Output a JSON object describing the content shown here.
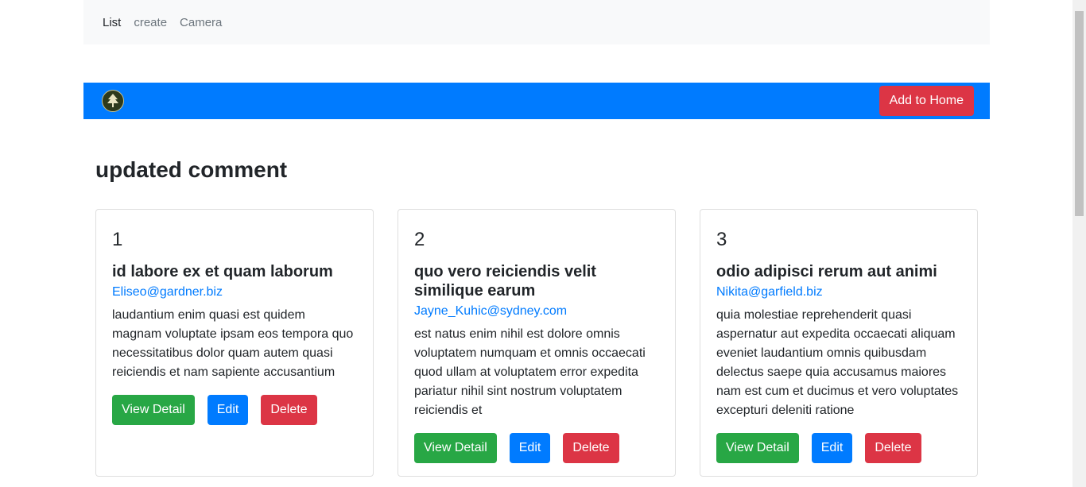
{
  "nav": {
    "items": [
      {
        "label": "List",
        "active": true
      },
      {
        "label": "create",
        "active": false
      },
      {
        "label": "Camera",
        "active": false
      }
    ]
  },
  "header": {
    "logo_icon": "tree-logo-icon",
    "add_home_label": "Add to Home",
    "bar_color": "#007bff"
  },
  "page_title": "updated comment",
  "buttons": {
    "view": "View Detail",
    "edit": "Edit",
    "delete": "Delete"
  },
  "cards": [
    {
      "id": "1",
      "title": "id labore ex et quam laborum",
      "email": "Eliseo@gardner.biz",
      "body": "laudantium enim quasi est quidem magnam voluptate ipsam eos tempora quo necessitatibus dolor quam autem quasi reiciendis et nam sapiente accusantium"
    },
    {
      "id": "2",
      "title": "quo vero reiciendis velit similique earum",
      "email": "Jayne_Kuhic@sydney.com",
      "body": "est natus enim nihil est dolore omnis voluptatem numquam et omnis occaecati quod ullam at voluptatem error expedita pariatur nihil sint nostrum voluptatem reiciendis et"
    },
    {
      "id": "3",
      "title": "odio adipisci rerum aut animi",
      "email": "Nikita@garfield.biz",
      "body": "quia molestiae reprehenderit quasi aspernatur aut expedita occaecati aliquam eveniet laudantium omnis quibusdam delectus saepe quia accusamus maiores nam est cum et ducimus et vero voluptates excepturi deleniti ratione"
    }
  ]
}
